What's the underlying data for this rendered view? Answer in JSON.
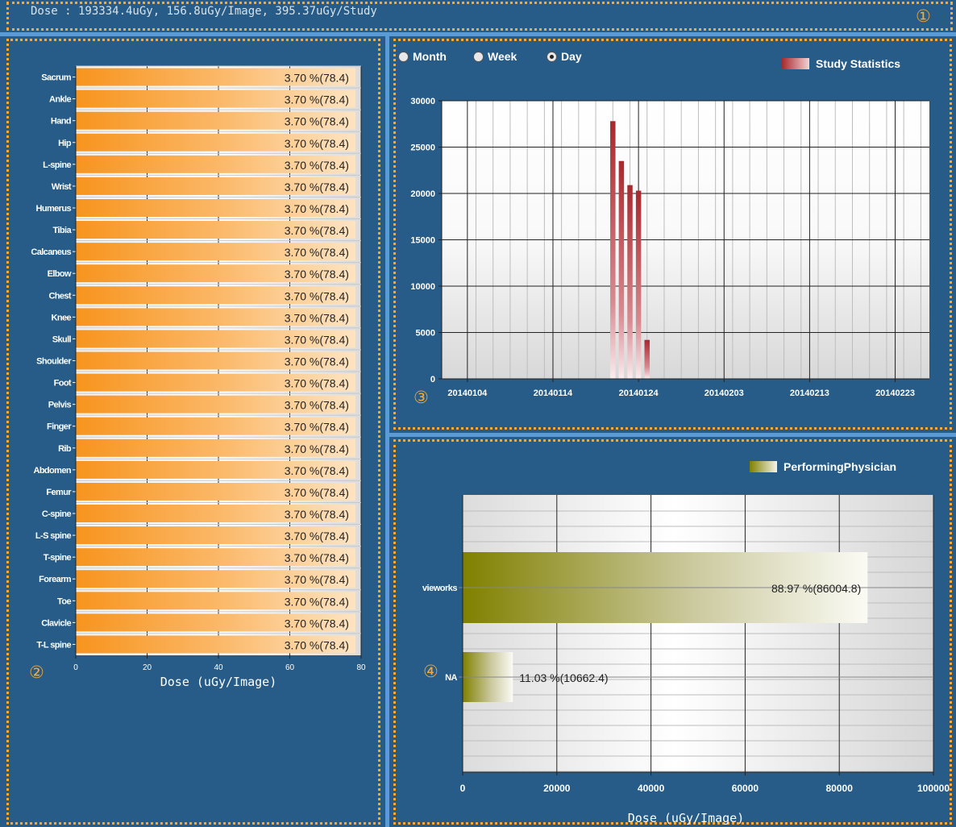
{
  "header": {
    "dose_summary": "Dose : 193334.4uGy, 156.8uGy/Image, 395.37uGy/Study",
    "marker": "①"
  },
  "colors": {
    "panel_bg": "#265c87",
    "window_bg": "#5b9bd5",
    "dotted_border": "#f2a93b",
    "body_part_bar": "#f7941d",
    "study_bar": "#a8282e",
    "physician_bar": "#808000"
  },
  "body_part_panel": {
    "marker": "②",
    "chart_data": {
      "type": "bar",
      "orientation": "horizontal",
      "categories": [
        "Sacrum",
        "Ankle",
        "Hand",
        "Hip",
        "L-spine",
        "Wrist",
        "Humerus",
        "Tibia",
        "Calcaneus",
        "Elbow",
        "Chest",
        "Knee",
        "Skull",
        "Shoulder",
        "Foot",
        "Pelvis",
        "Finger",
        "Rib",
        "Abdomen",
        "Femur",
        "C-spine",
        "L-S spine",
        "T-spine",
        "Forearm",
        "Toe",
        "Clavicle",
        "T-L spine"
      ],
      "values": [
        78.4,
        78.4,
        78.4,
        78.4,
        78.4,
        78.4,
        78.4,
        78.4,
        78.4,
        78.4,
        78.4,
        78.4,
        78.4,
        78.4,
        78.4,
        78.4,
        78.4,
        78.4,
        78.4,
        78.4,
        78.4,
        78.4,
        78.4,
        78.4,
        78.4,
        78.4,
        78.4
      ],
      "labels": [
        "3.70 %(78.4)",
        "3.70 %(78.4)",
        "3.70 %(78.4)",
        "3.70 %(78.4)",
        "3.70 %(78.4)",
        "3.70 %(78.4)",
        "3.70 %(78.4)",
        "3.70 %(78.4)",
        "3.70 %(78.4)",
        "3.70 %(78.4)",
        "3.70 %(78.4)",
        "3.70 %(78.4)",
        "3.70 %(78.4)",
        "3.70 %(78.4)",
        "3.70 %(78.4)",
        "3.70 %(78.4)",
        "3.70 %(78.4)",
        "3.70 %(78.4)",
        "3.70 %(78.4)",
        "3.70 %(78.4)",
        "3.70 %(78.4)",
        "3.70 %(78.4)",
        "3.70 %(78.4)",
        "3.70 %(78.4)",
        "3.70 %(78.4)",
        "3.70 %(78.4)",
        "3.70 %(78.4)"
      ],
      "xlim": [
        0,
        80
      ],
      "xticks": [
        0,
        20,
        40,
        60,
        80
      ],
      "xlabel": "Dose (uGy/Image)",
      "grid": true
    }
  },
  "study_panel": {
    "marker": "③",
    "period_options": [
      {
        "label": "Month",
        "selected": false
      },
      {
        "label": "Week",
        "selected": false
      },
      {
        "label": "Day",
        "selected": true
      }
    ],
    "chart_data": {
      "type": "bar",
      "series": [
        {
          "name": "Study Statistics",
          "values": [
            27800,
            23500,
            20900,
            20300,
            4200
          ]
        }
      ],
      "x": [
        "20140121",
        "20140122",
        "20140123",
        "20140124",
        "20140125"
      ],
      "xticks": [
        "20140104",
        "20140114",
        "20140124",
        "20140203",
        "20140213",
        "20140223"
      ],
      "xlim": [
        "20140101",
        "20140227"
      ],
      "ylim": [
        0,
        30000
      ],
      "yticks": [
        0,
        5000,
        10000,
        15000,
        20000,
        25000,
        30000
      ],
      "grid": true,
      "legend": "top-right"
    }
  },
  "physician_panel": {
    "marker": "④",
    "chart_data": {
      "type": "bar",
      "orientation": "horizontal",
      "series": [
        {
          "name": "PerformingPhysician",
          "values": [
            86004.8,
            10662.4
          ]
        }
      ],
      "categories": [
        "vieworks",
        "NA"
      ],
      "labels": [
        "88.97 %(86004.8)",
        "11.03 %(10662.4)"
      ],
      "xlim": [
        0,
        100000
      ],
      "xticks": [
        0,
        20000,
        40000,
        60000,
        80000,
        100000
      ],
      "xlabel": "Dose (uGy/Image)",
      "grid": true,
      "legend": "top-right"
    }
  }
}
